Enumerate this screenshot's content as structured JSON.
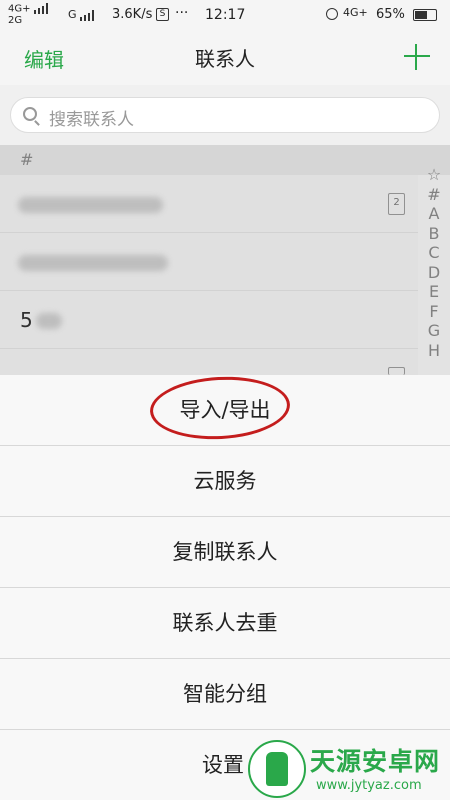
{
  "status_bar": {
    "sim1_label": "4G+",
    "sim1_sub": "2G",
    "sim2_label": "G",
    "speed": "3.6K/s",
    "notif_icon": "S",
    "more": "···",
    "time": "12:17",
    "network": "4G+",
    "battery_pct": "65%",
    "battery_level": 0.65
  },
  "header": {
    "edit": "编辑",
    "title": "联系人",
    "add_icon": "plus-icon"
  },
  "search": {
    "placeholder": "搜索联系人"
  },
  "list": {
    "section": "#",
    "sim_badge": "2",
    "row3_text": "5"
  },
  "index_bar": [
    "☆",
    "#",
    "A",
    "B",
    "C",
    "D",
    "E",
    "F",
    "G",
    "H"
  ],
  "menu": {
    "items": [
      "导入/导出",
      "云服务",
      "复制联系人",
      "联系人去重",
      "智能分组",
      "设置"
    ]
  },
  "watermark": {
    "name": "天源安卓网",
    "url": "www.jytyaz.com"
  },
  "colors": {
    "accent": "#2aa84a",
    "annotation": "#c41d1d"
  }
}
